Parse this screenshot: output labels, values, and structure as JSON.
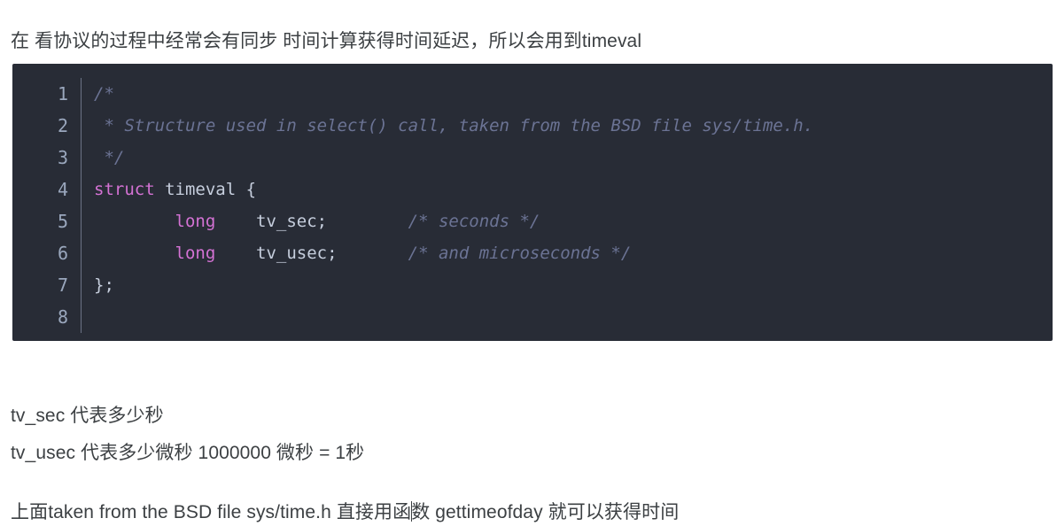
{
  "document": {
    "intro_paragraph": "在 看协议的过程中经常会有同步 时间计算获得时间延迟，所以会用到timeval",
    "note_tv_sec": "tv_sec 代表多少秒",
    "note_tv_usec": "tv_usec 代表多少微秒 1000000 微秒 = 1秒",
    "footer_before_caret": "上面taken from the BSD file sys/time.h 直接用函",
    "footer_after_caret": "数 gettimeofday 就可以获得时间"
  },
  "code_block": {
    "language": "c",
    "line_numbers": [
      "1",
      "2",
      "3",
      "4",
      "5",
      "6",
      "7",
      "8"
    ],
    "background_color": "#282c36",
    "comment_color": "#6b7394",
    "keyword_color": "#d472d4",
    "text_color": "#c6cedd",
    "gutter_color": "#9aa7bd",
    "lines": [
      {
        "n": "1",
        "tokens": [
          {
            "t": "comment",
            "v": "/*"
          }
        ]
      },
      {
        "n": "2",
        "tokens": [
          {
            "t": "comment",
            "v": " * Structure used in select() call, taken from the BSD file sys/time.h."
          }
        ]
      },
      {
        "n": "3",
        "tokens": [
          {
            "t": "comment",
            "v": " */"
          }
        ]
      },
      {
        "n": "4",
        "tokens": [
          {
            "t": "keyword",
            "v": "struct"
          },
          {
            "t": "plain",
            "v": " timeval {"
          }
        ]
      },
      {
        "n": "5",
        "tokens": [
          {
            "t": "plain",
            "v": "        "
          },
          {
            "t": "keyword",
            "v": "long"
          },
          {
            "t": "plain",
            "v": "    tv_sec;        "
          },
          {
            "t": "comment",
            "v": "/* seconds */"
          }
        ]
      },
      {
        "n": "6",
        "tokens": [
          {
            "t": "plain",
            "v": "        "
          },
          {
            "t": "keyword",
            "v": "long"
          },
          {
            "t": "plain",
            "v": "    tv_usec;       "
          },
          {
            "t": "comment",
            "v": "/* and microseconds */"
          }
        ]
      },
      {
        "n": "7",
        "tokens": [
          {
            "t": "plain",
            "v": "};"
          }
        ]
      },
      {
        "n": "8",
        "tokens": [
          {
            "t": "plain",
            "v": ""
          }
        ]
      }
    ]
  }
}
